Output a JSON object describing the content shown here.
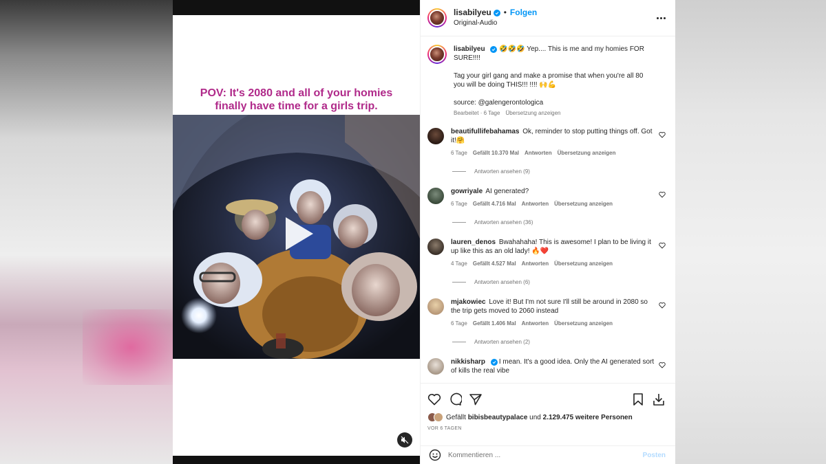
{
  "media": {
    "caption_text": "POV: It's 2080 and all of your homies\nfinally have time for a girls trip.",
    "play_icon": "play-icon",
    "mute_icon": "muted-speaker-icon"
  },
  "header": {
    "username": "lisabilyeu",
    "verified": true,
    "separator": "•",
    "follow_label": "Folgen",
    "audio": "Original-Audio"
  },
  "caption": {
    "username": "lisabilyeu",
    "line1": "🤣🤣🤣 Yep.... This is me and my homies FOR SURE!!!!",
    "line2": "Tag your girl gang and make a promise that when you're all 80 you will be doing THIS!!! !!!! 🙌💪",
    "line3": "source: @galengerontologica",
    "edited": "Bearbeitet · 6 Tage",
    "translate": "Übersetzung anzeigen"
  },
  "comments": [
    {
      "username": "beautifullifebahamas",
      "text": "Ok, reminder to stop putting things off. Got it!🤗",
      "age": "6 Tage",
      "likes": "Gefällt 10.370 Mal",
      "reply": "Antworten",
      "translate": "Übersetzung anzeigen",
      "replies": "Antworten ansehen (9)"
    },
    {
      "username": "gowriyale",
      "text": "AI generated?",
      "age": "6 Tage",
      "likes": "Gefällt 4.716 Mal",
      "reply": "Antworten",
      "translate": "Übersetzung anzeigen",
      "replies": "Antworten ansehen (36)"
    },
    {
      "username": "lauren_denos",
      "text": "Bwahahaha! This is awesome! I plan to be living it up like this as an old lady! 🔥❤️",
      "age": "4 Tage",
      "likes": "Gefällt 4.527 Mal",
      "reply": "Antworten",
      "translate": "Übersetzung anzeigen",
      "replies": "Antworten ansehen (6)"
    },
    {
      "username": "mjakowiec",
      "text": "Love it! But I'm not sure I'll still be around in 2080 so the trip gets moved to 2060 instead",
      "age": "6 Tage",
      "likes": "Gefällt 1.406 Mal",
      "reply": "Antworten",
      "translate": "Übersetzung anzeigen",
      "replies": "Antworten ansehen (2)"
    },
    {
      "username": "nikkisharp",
      "text": "I mean. It's a good idea. Only the AI generated sort of kills the real vibe"
    }
  ],
  "actions": {
    "likes_prefix": "Gefällt",
    "likes_user": "bibisbeautypalace",
    "likes_and": "und",
    "likes_count": "2.129.475 weitere Personen",
    "time_ago": "VOR 6 TAGEN",
    "comment_placeholder": "Kommentieren ...",
    "post_label": "Posten"
  },
  "colors": {
    "accent": "#0095f6",
    "caption_pink": "#b02a8a"
  }
}
